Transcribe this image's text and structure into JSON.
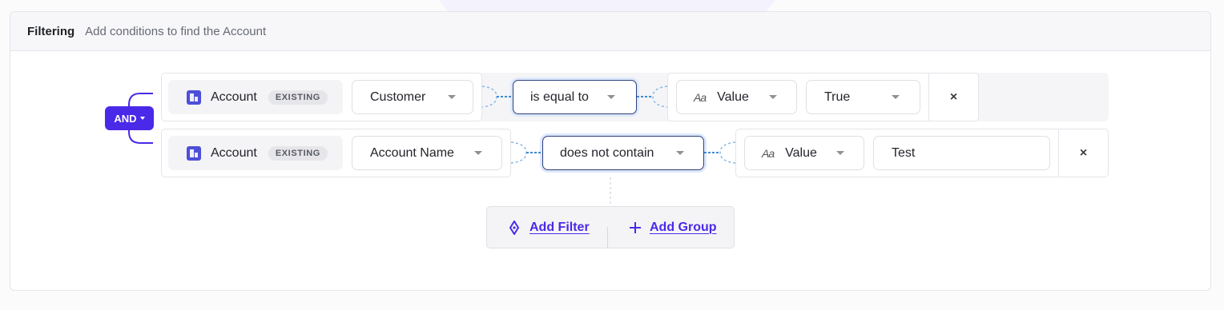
{
  "header": {
    "title": "Filtering",
    "subtitle": "Add conditions to find the Account"
  },
  "group": {
    "operator": "AND"
  },
  "filters": [
    {
      "entity": "Account",
      "badge": "EXISTING",
      "field": "Customer",
      "operator": "is equal to",
      "value_type": "Value",
      "value": "True",
      "value_is_dropdown": true,
      "remove": "×"
    },
    {
      "entity": "Account",
      "badge": "EXISTING",
      "field": "Account Name",
      "operator": "does not contain",
      "value_type": "Value",
      "value": "Test",
      "value_is_dropdown": false,
      "remove": "×"
    }
  ],
  "actions": {
    "add_filter": "Add Filter",
    "add_group": "Add Group"
  },
  "colors": {
    "accent": "#4b29e8",
    "entity_icon": "#4d4fd9",
    "connector": "#3f8ad4"
  },
  "icons": {
    "entity": "building-icon",
    "value_type": "text-case-icon",
    "add_filter": "filter-node-icon",
    "add_group": "plus-icon",
    "remove": "close-icon"
  }
}
